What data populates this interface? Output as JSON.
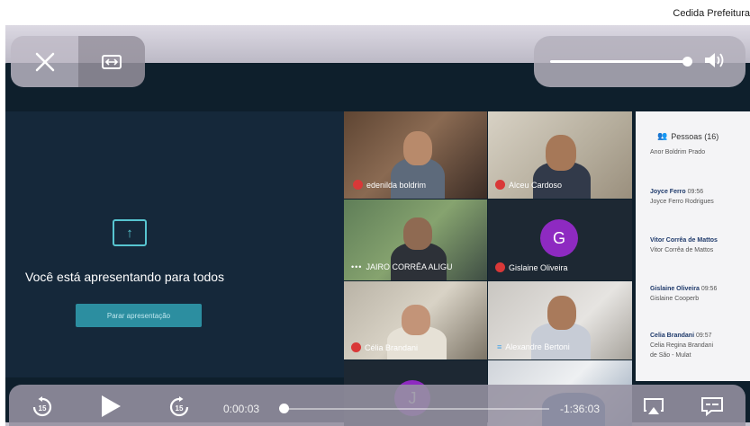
{
  "credit": "Cedida Prefeitura",
  "presentation": {
    "message": "Você está apresentando para todos",
    "stop_button": "Parar apresentação"
  },
  "participants": [
    {
      "name": "edenilda boldrim",
      "mic": "muted"
    },
    {
      "name": "Alceu Cardoso",
      "mic": "muted"
    },
    {
      "name": "JAIRO CORRÊA ALIGU",
      "mic": "more"
    },
    {
      "name": "Gislaine Oliveira",
      "mic": "muted",
      "initial": "G"
    },
    {
      "name": "Célia Brandani",
      "mic": "muted"
    },
    {
      "name": "Alexandre Bertoni",
      "mic": "speaking"
    },
    {
      "name": "",
      "initial": "J"
    }
  ],
  "people_panel": {
    "header": "Pessoas (16)",
    "top_line": "Anor Boldrim Prado",
    "messages": [
      {
        "name": "Joyce Ferro",
        "time": "09:56",
        "text": "Joyce Ferro Rodrigues"
      },
      {
        "name": "Vitor Corrêa de Mattos",
        "time": "",
        "text": "Vitor Corrêa de Mattos"
      },
      {
        "name": "Gislaine Oliveira",
        "time": "09:56",
        "text": "Gislaine Cooperb"
      },
      {
        "name": "Celia Brandani",
        "time": "09:57",
        "text": "Celia Regina Brandani",
        "extra": "de São - Mulat"
      }
    ]
  },
  "player": {
    "elapsed": "0:00:03",
    "remaining": "-1:36:03",
    "skip_back_seconds": "15",
    "skip_forward_seconds": "15",
    "progress": 0.001,
    "volume": 0.95
  },
  "icons": {
    "close": "close-icon",
    "fit": "aspect-ratio-icon",
    "speaker": "speaker-icon",
    "airplay": "airplay-icon",
    "subtitles": "subtitles-icon"
  }
}
